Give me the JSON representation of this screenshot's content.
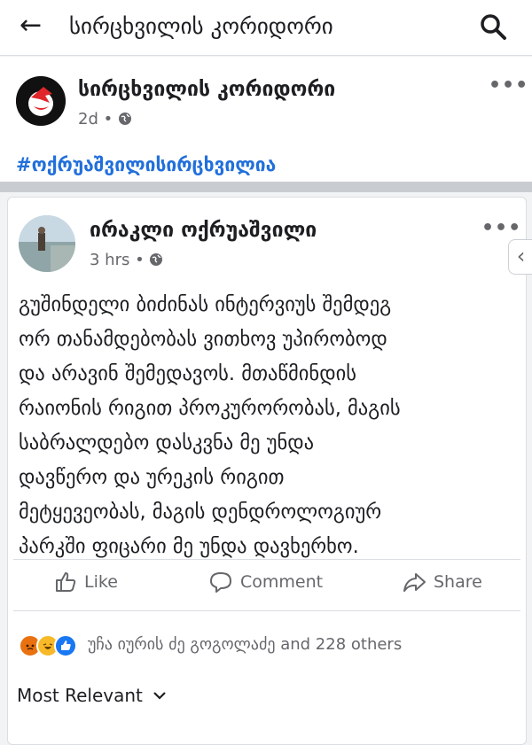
{
  "topbar": {
    "back_icon": "←",
    "title": "სირცხვილის კორიდორი"
  },
  "page_post": {
    "name": "სირცხვილის კორიდორი",
    "time": "2d",
    "dots": "•••",
    "hashtag": "#ოქრუაშვილისირცხვილია"
  },
  "shared_post": {
    "author": "ირაკლი ოქრუაშვილი",
    "time": "3 hrs",
    "dots": "•••",
    "text": "გუშინდელი ბიძინას ინტერვიუს შემდეგ\nორ თანამდებობას ვითხოვ უპირობოდ\nდა არავინ შემედავოს. მთაწმინდის\nრაიონის რიგით პროკურორობას, მაგის\nსაბრალდებო დასკვნა მე უნდა\nდავწერო და ურეკის რიგით\nმეტყევეობას, მაგის დენდროლოგიურ\nპარკში ფიცარი მე უნდა დავხერხო."
  },
  "actions": {
    "like": "Like",
    "comment": "Comment",
    "share": "Share"
  },
  "reactions": {
    "text": "უჩა იურის ძე გოგოლაძე and 228 others"
  },
  "comments_filter": {
    "label": "Most Relevant"
  },
  "side_tab": {
    "icon": "‹"
  },
  "colors": {
    "link": "#216fdb",
    "secondary_text": "#65676b",
    "angry": "#e9710f",
    "like": "#1877f2"
  }
}
